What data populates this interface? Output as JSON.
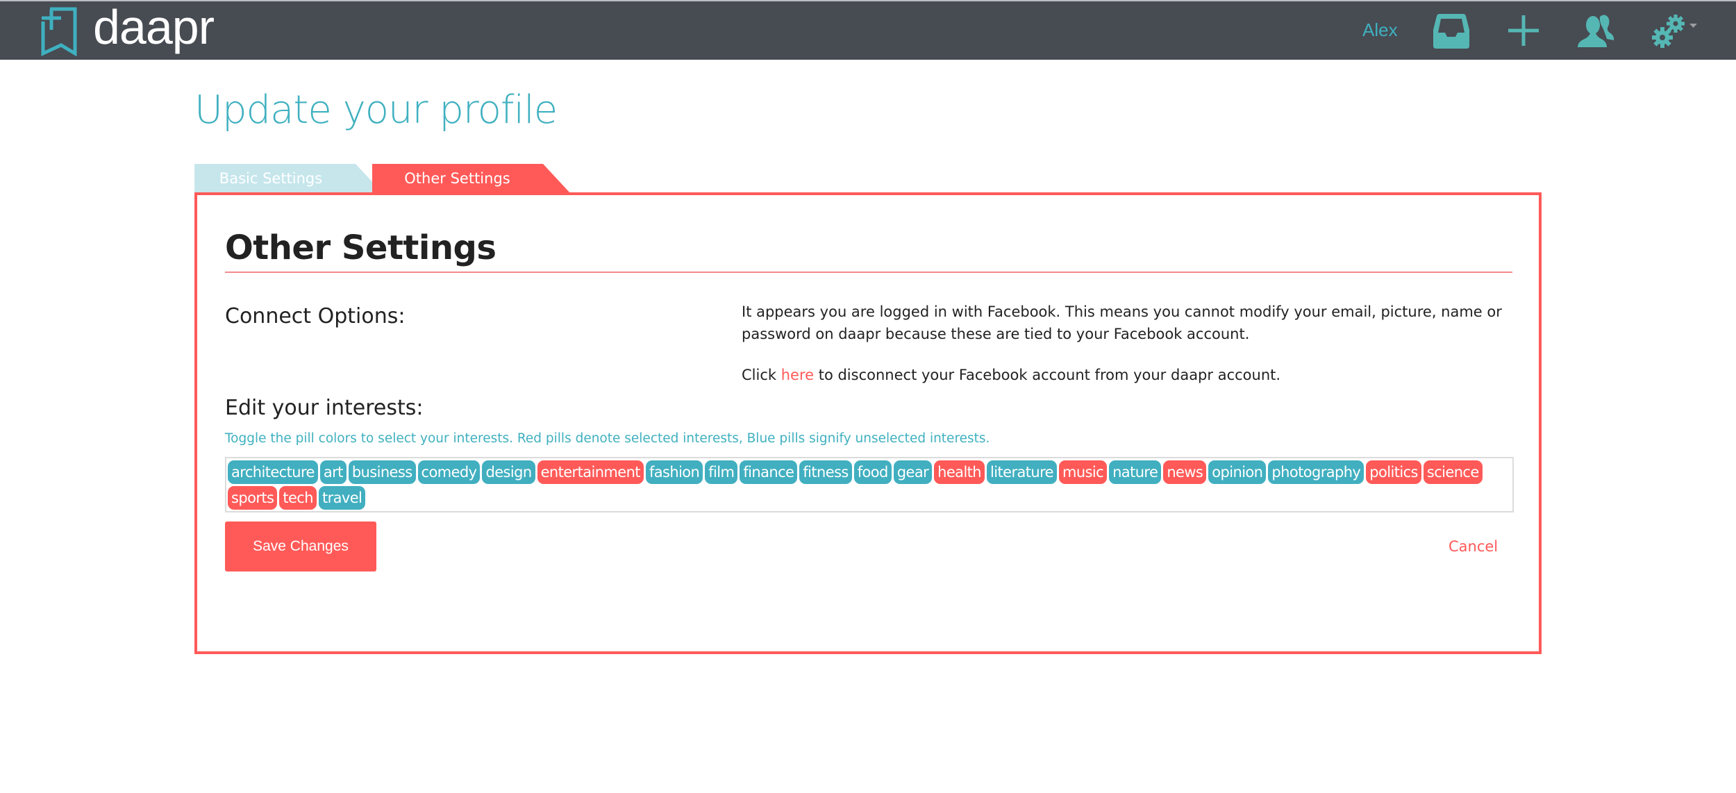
{
  "colors": {
    "nav_bg": "#474b52",
    "accent_teal": "#3fb0c0",
    "accent_red": "#ff5a58",
    "tab_inactive": "#c6e6ec",
    "pill_unselected": "#41afc0",
    "pill_selected": "#ff5a58"
  },
  "navbar": {
    "brand_name": "daapr",
    "brand_icon": "bookmark-plus-icon",
    "user_name": "Alex",
    "icons": [
      "inbox-icon",
      "plus-icon",
      "users-icon",
      "gears-icon"
    ],
    "settings_dropdown_icon": "caret-down-icon"
  },
  "page": {
    "title": "Update your profile"
  },
  "tabs": [
    {
      "label": "Basic Settings",
      "active": false
    },
    {
      "label": "Other Settings",
      "active": true
    }
  ],
  "panel": {
    "title": "Other Settings",
    "connect": {
      "label": "Connect Options:",
      "message": "It appears you are logged in with Facebook. This means you cannot modify your email, picture, name or password on daapr because these are tied to your Facebook account.",
      "disconnect_prefix": "Click ",
      "disconnect_link": "here",
      "disconnect_suffix": " to disconnect your Facebook account from your daapr account."
    },
    "interests": {
      "label": "Edit your interests:",
      "help": "Toggle the pill colors to select your interests. Red pills denote selected interests, Blue pills signify unselected interests.",
      "pills": [
        {
          "label": "architecture",
          "selected": false
        },
        {
          "label": "art",
          "selected": false
        },
        {
          "label": "business",
          "selected": false
        },
        {
          "label": "comedy",
          "selected": false
        },
        {
          "label": "design",
          "selected": false
        },
        {
          "label": "entertainment",
          "selected": true
        },
        {
          "label": "fashion",
          "selected": false
        },
        {
          "label": "film",
          "selected": false
        },
        {
          "label": "finance",
          "selected": false
        },
        {
          "label": "fitness",
          "selected": false
        },
        {
          "label": "food",
          "selected": false
        },
        {
          "label": "gear",
          "selected": false
        },
        {
          "label": "health",
          "selected": true
        },
        {
          "label": "literature",
          "selected": false
        },
        {
          "label": "music",
          "selected": true
        },
        {
          "label": "nature",
          "selected": false
        },
        {
          "label": "news",
          "selected": true
        },
        {
          "label": "opinion",
          "selected": false
        },
        {
          "label": "photography",
          "selected": false
        },
        {
          "label": "politics",
          "selected": true
        },
        {
          "label": "science",
          "selected": true
        },
        {
          "label": "sports",
          "selected": true
        },
        {
          "label": "tech",
          "selected": true
        },
        {
          "label": "travel",
          "selected": false
        }
      ]
    },
    "actions": {
      "save_label": "Save Changes",
      "cancel_label": "Cancel"
    }
  }
}
